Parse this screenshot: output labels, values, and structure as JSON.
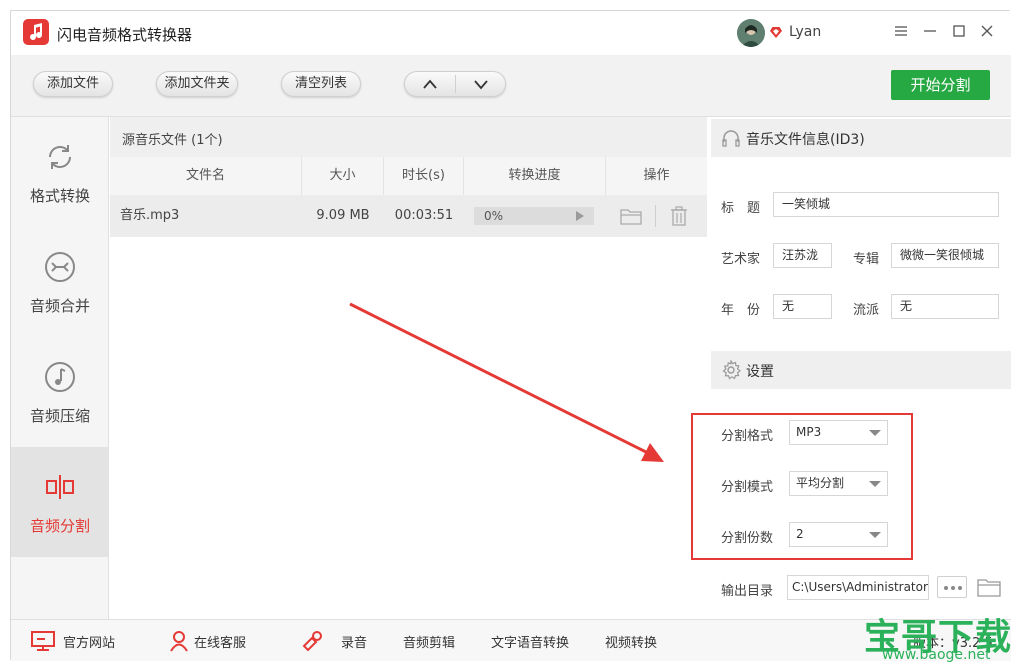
{
  "app": {
    "title": "闪电音频格式转换器",
    "username": "Lyan",
    "brand_color": "#e53935",
    "start_color": "#26a843"
  },
  "toolbar": {
    "add_file": "添加文件",
    "add_folder": "添加文件夹",
    "clear_list": "清空列表",
    "move_up_icon": "chevron-up-icon",
    "move_down_icon": "chevron-down-icon",
    "start": "开始分割"
  },
  "sidebar": {
    "items": [
      {
        "label": "格式转换",
        "icon": "refresh-icon"
      },
      {
        "label": "音频合并",
        "icon": "merge-icon"
      },
      {
        "label": "音频压缩",
        "icon": "music-note-icon"
      },
      {
        "label": "音频分割",
        "icon": "split-icon"
      }
    ],
    "active_index": 3
  },
  "filelist": {
    "title": "源音乐文件 (1个)",
    "columns": [
      "文件名",
      "大小",
      "时长(s)",
      "转换进度",
      "操作"
    ],
    "rows": [
      {
        "name": "音乐.mp3",
        "size": "9.09 MB",
        "duration": "00:03:51",
        "progress": "0%",
        "progress_value": 0
      }
    ]
  },
  "id3": {
    "title": "音乐文件信息(ID3)",
    "title_label": "标　题",
    "title_value": "一笑倾城",
    "artist_label": "艺术家",
    "artist_value": "汪苏泷",
    "album_label": "专辑",
    "album_value": "微微一笑很倾城",
    "year_label": "年　份",
    "year_value": "无",
    "genre_label": "流派",
    "genre_value": "无"
  },
  "settings": {
    "title": "设置",
    "format_label": "分割格式",
    "format_value": "MP3",
    "mode_label": "分割模式",
    "mode_value": "平均分割",
    "count_label": "分割份数",
    "count_value": "2",
    "output_label": "输出目录",
    "output_value": "C:\\Users\\Administrator"
  },
  "bottombar": {
    "website": "官方网站",
    "support": "在线客服",
    "record": "录音",
    "cut": "音频剪辑",
    "tts": "文字语音转换",
    "video": "视频转换",
    "version": "版本：v3.2.5"
  },
  "watermark": {
    "main": "宝哥下载",
    "url": "www.baoge.net"
  }
}
